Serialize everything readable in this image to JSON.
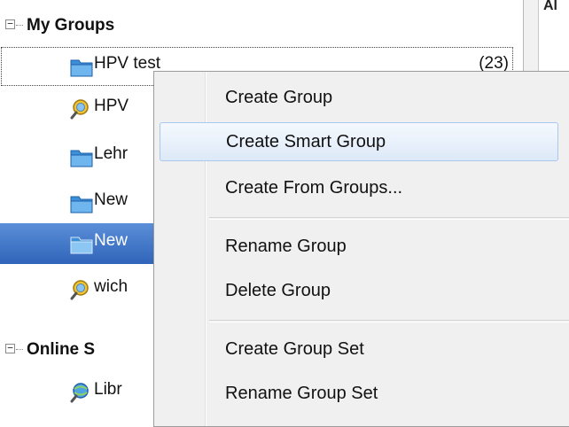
{
  "sidebar": {
    "my_groups": {
      "title": "My Groups",
      "expander": "−",
      "items": [
        {
          "label": "HPV test",
          "count": "(23)",
          "icon": "folder-icon"
        },
        {
          "label": "HPV",
          "icon": "smart-group-icon"
        },
        {
          "label": "Lehr",
          "icon": "folder-icon"
        },
        {
          "label": "New",
          "icon": "folder-icon"
        },
        {
          "label": "New",
          "icon": "folder-icon",
          "selected": true
        },
        {
          "label": "wich",
          "icon": "smart-group-icon"
        }
      ]
    },
    "online": {
      "title": "Online S",
      "expander": "−",
      "items": [
        {
          "label": "Libr",
          "icon": "online-search-icon"
        }
      ]
    }
  },
  "right_pane": {
    "partial_text": "Al"
  },
  "context_menu": {
    "items": [
      {
        "label": "Create Group"
      },
      {
        "label": "Create Smart Group",
        "highlighted": true
      },
      {
        "label": "Create From Groups..."
      },
      {
        "label": "Rename Group"
      },
      {
        "label": "Delete Group"
      },
      {
        "label": "Create Group Set"
      },
      {
        "label": "Rename Group Set"
      }
    ]
  },
  "colors": {
    "selection": "#2f64b9",
    "menu_background": "#f0f0f0",
    "menu_hover_border": "#a8c8ef"
  }
}
